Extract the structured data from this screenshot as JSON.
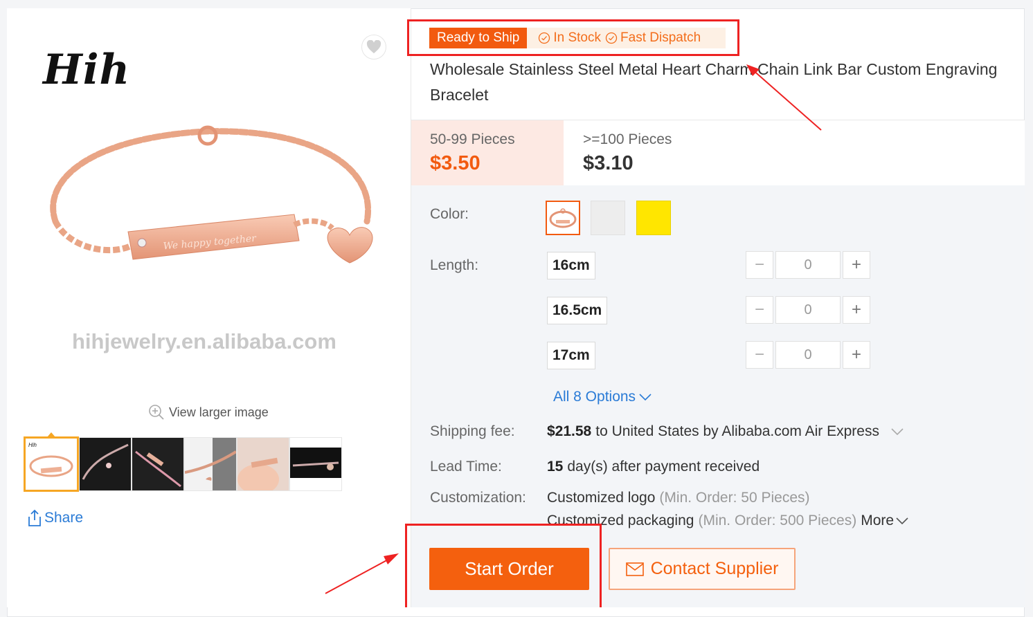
{
  "gallery": {
    "brand_logo": "Hih",
    "watermark": "hihjewelry.en.alibaba.com",
    "view_larger": "View larger image",
    "share": "Share",
    "thumbnail_count": 6
  },
  "product": {
    "badge_ready": "Ready to Ship",
    "badge_stock": "In Stock",
    "badge_dispatch": "Fast Dispatch",
    "title": "Wholesale Stainless Steel Metal Heart Charm Chain Link Bar Custom Engraving Bracelet"
  },
  "pricing": {
    "tiers": [
      {
        "qty": "50-99 Pieces",
        "price": "$3.50"
      },
      {
        "qty": ">=100 Pieces",
        "price": "$3.10"
      }
    ]
  },
  "attributes": {
    "color_label": "Color:",
    "colors": [
      "rose gold",
      "silver",
      "gold"
    ],
    "length_label": "Length:",
    "lengths": [
      {
        "label": "16cm",
        "qty": "0"
      },
      {
        "label": "16.5cm",
        "qty": "0"
      },
      {
        "label": "17cm",
        "qty": "0"
      }
    ],
    "all_options": "All 8 Options",
    "shipping_label": "Shipping fee:",
    "shipping_amount": "$21.58",
    "shipping_text": "to United States by Alibaba.com Air Express",
    "lead_label": "Lead Time:",
    "lead_days": "15",
    "lead_text": "day(s) after payment received",
    "custom_label": "Customization:",
    "custom_logo": "Customized logo",
    "custom_logo_min": "(Min. Order: 50 Pieces)",
    "custom_pack": "Customized packaging",
    "custom_pack_min": "(Min. Order: 500 Pieces)",
    "more": "More"
  },
  "actions": {
    "start_order": "Start Order",
    "contact_supplier": "Contact Supplier"
  },
  "colors": {
    "accent": "#f4600e",
    "link": "#2a7bd6",
    "annotation": "#e22222"
  }
}
